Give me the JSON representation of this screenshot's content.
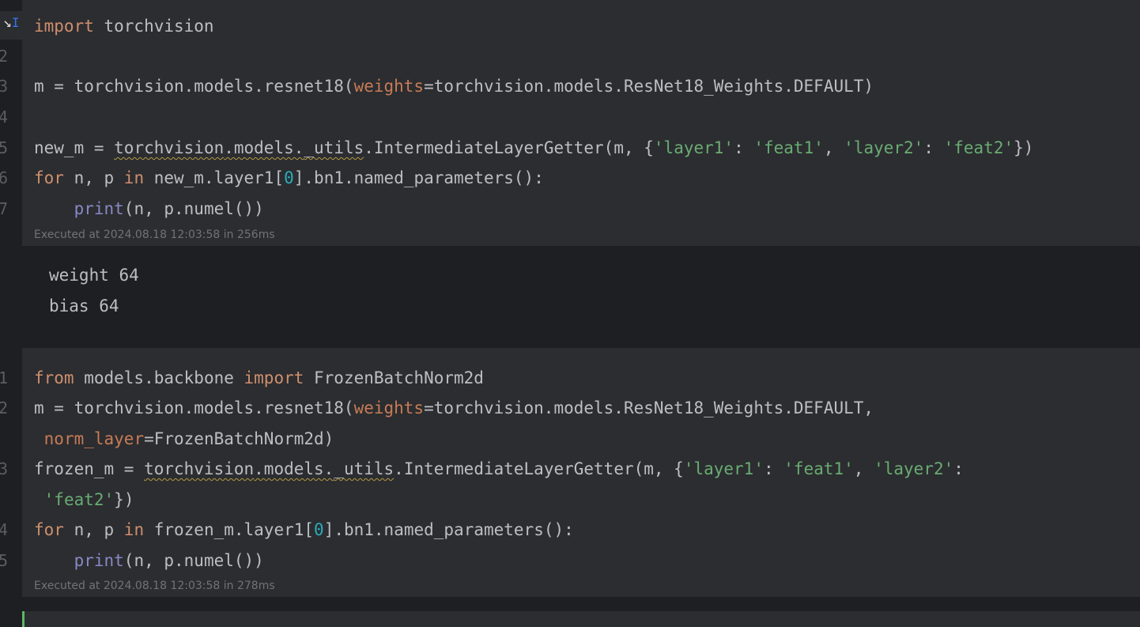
{
  "cell1": {
    "line_numbers": [
      "2",
      "3",
      "4",
      "5",
      "6",
      "7"
    ],
    "code": {
      "l1": {
        "kw": "import",
        "rest": " torchvision"
      },
      "l3": {
        "a": "m = torchvision.models.resnet18(",
        "param": "weights",
        "b": "=torchvision.models.ResNet18_Weights.DEFAULT)"
      },
      "l5": {
        "a": "new_m = ",
        "sq1": "torchvision",
        "dot1": ".models.",
        "sq2": "_utils",
        "b": ".IntermediateLayerGetter(m, {",
        "s1": "'layer1'",
        "c1": ": ",
        "s2": "'feat1'",
        "c2": ", ",
        "s3": "'layer2'",
        "c3": ": ",
        "s4": "'feat2'",
        "end": "})"
      },
      "l6": {
        "kw1": "for",
        "a": " n, p ",
        "kw2": "in",
        "b": " new_m.layer1[",
        "num": "0",
        "c": "].bn1.named_parameters():"
      },
      "l7": {
        "indent": "    ",
        "bi": "print",
        "a": "(n, p.numel())"
      }
    },
    "meta": "Executed at 2024.08.18 12:03:58 in 256ms"
  },
  "output1": {
    "lines": [
      "weight 64",
      "bias 64"
    ]
  },
  "cell2": {
    "line_numbers": [
      "1",
      "2",
      "3",
      "4",
      "5"
    ],
    "code": {
      "l1": {
        "kw1": "from",
        "a": " models.backbone ",
        "kw2": "import",
        "b": " FrozenBatchNorm2d"
      },
      "l2a": {
        "a": "m = torchvision.models.resnet18(",
        "param": "weights",
        "b": "=torchvision.models.ResNet18_Weights.DEFAULT,"
      },
      "l2b": {
        "sp": " ",
        "param": "norm_layer",
        "b": "=FrozenBatchNorm2d)"
      },
      "l3a": {
        "a": "frozen_m = ",
        "sq1": "torchvision",
        "dot1": ".models.",
        "sq2": "_utils",
        "b": ".IntermediateLayerGetter(m, {",
        "s1": "'layer1'",
        "c1": ": ",
        "s2": "'feat1'",
        "c2": ", ",
        "s3": "'layer2'",
        "c3": ":"
      },
      "l3b": {
        "sp": " ",
        "s4": "'feat2'",
        "end": "})"
      },
      "l4": {
        "kw1": "for",
        "a": " n, p ",
        "kw2": "in",
        "b": " frozen_m.layer1[",
        "num": "0",
        "c": "].bn1.named_parameters():"
      },
      "l5": {
        "indent": "    ",
        "bi": "print",
        "a": "(n, p.numel())"
      }
    },
    "meta": "Executed at 2024.08.18 12:03:58 in 278ms"
  },
  "icons": {
    "run": "expand-arrow-icon",
    "cursor": "text-cursor-icon"
  },
  "colors": {
    "keyword": "#cf8e6d",
    "param": "#c77b56",
    "string": "#6aab73",
    "number": "#2aacb8",
    "builtin": "#8888c6",
    "active": "#5fb865"
  }
}
